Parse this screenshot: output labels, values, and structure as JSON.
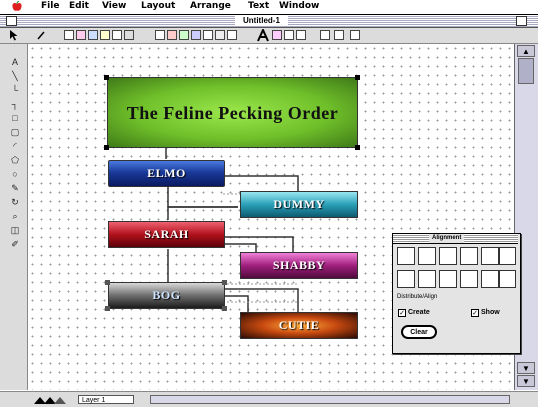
{
  "menu": {
    "items": [
      "File",
      "Edit",
      "View",
      "Layout",
      "Arrange",
      "Text",
      "Window"
    ]
  },
  "window": {
    "title": "Untitled-1"
  },
  "diagram": {
    "title": "The Feline Pecking Order",
    "nodes": [
      {
        "label": "ELMO"
      },
      {
        "label": "DUMMY"
      },
      {
        "label": "SARAH"
      },
      {
        "label": "SHABBY"
      },
      {
        "label": "BOG"
      },
      {
        "label": "CUTIE"
      }
    ]
  },
  "alignment_palette": {
    "title": "Alignment",
    "section_label": "Distribute/Align",
    "create_label": "Create",
    "show_label": "Show",
    "clear_label": "Clear"
  },
  "status": {
    "layer": "Layer 1"
  },
  "colors": {
    "title_box": "#6fbf2a",
    "elmo": "#1a3a9a",
    "dummy": "#2aa0b8",
    "sarah": "#b0121c",
    "shabby": "#a0207e",
    "bog": "#6e6e6e",
    "cutie": "#c84a10"
  }
}
